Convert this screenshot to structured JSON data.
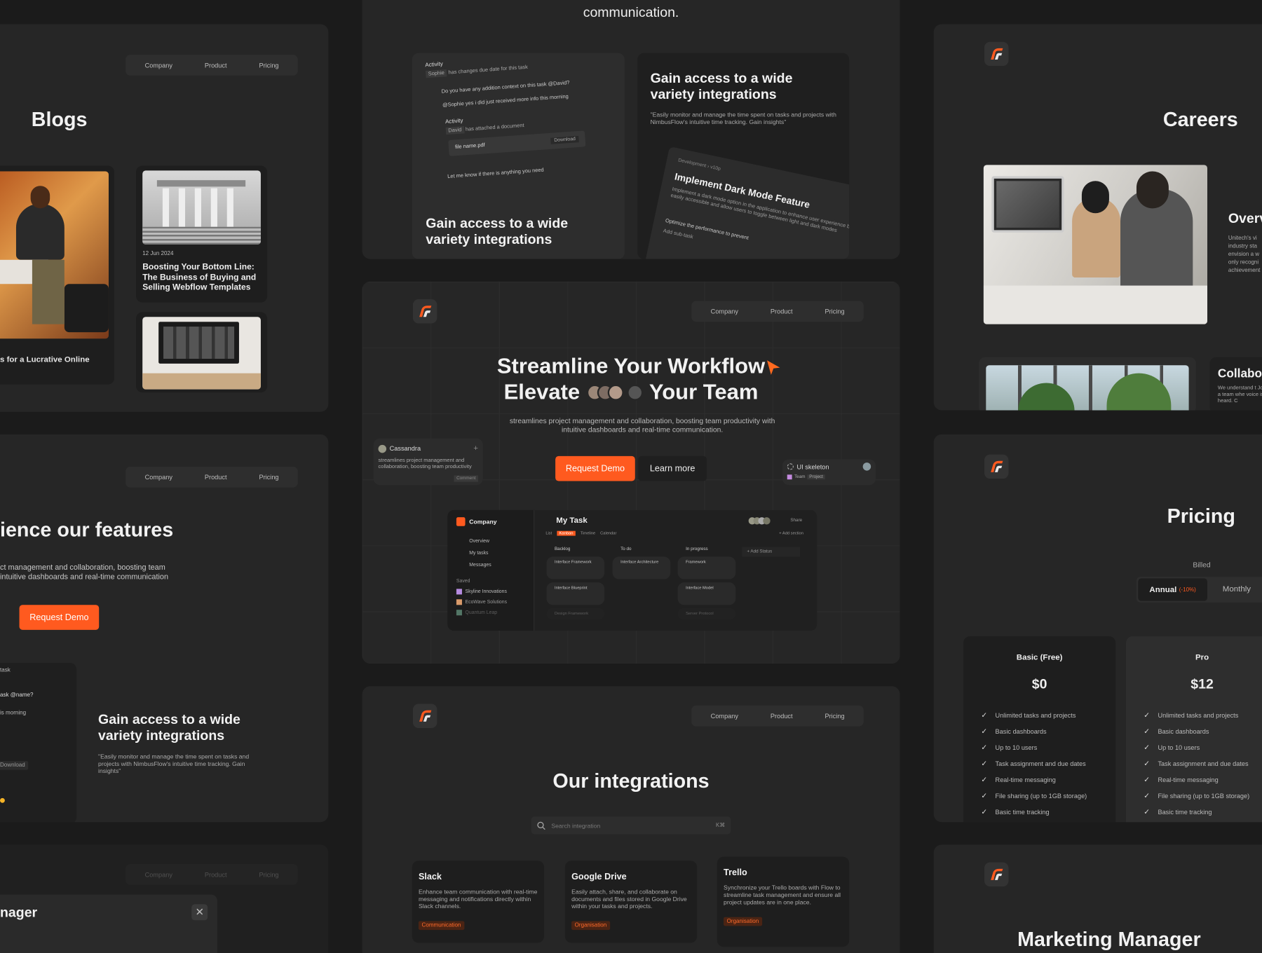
{
  "nav": {
    "company": "Company",
    "product": "Product",
    "pricing": "Pricing"
  },
  "blogs": {
    "title": "Blogs",
    "card1_date": "12 Jun 2024",
    "card1_title": "Boosting Your Bottom Line: The Business of Buying and Selling Webflow Templates",
    "card_left_caption": "s for a Lucrative Online"
  },
  "features": {
    "title": "ience our features",
    "desc": "ct management and collaboration, boosting team intuitive dashboards and real-time communication",
    "button": "Request Demo",
    "gain_title": "Gain access to a wide variety integrations",
    "gain_desc": "\"Easily monitor and manage the time spent on tasks and projects with NimbusFlow's intuitive time tracking. Gain insights\"",
    "chat_lines": [
      "task",
      "ask @name?",
      "is morning",
      "Download"
    ]
  },
  "manager_partial": {
    "title": "nager"
  },
  "top_center": {
    "text": "communication.",
    "activity_label": "Activity",
    "sophie": "Sophie",
    "sophie_action": "has changes due date for this task",
    "q1": "Do you have any addition context on this task @David?",
    "q2": "@Sophie yes i did just received more info this morning",
    "activity2": "Activity",
    "david": "David",
    "david_action": "has attached a document",
    "file": "file name.pdf",
    "download": "Download",
    "last": "Let me know if there is anything you need",
    "gain_left": "Gain access to a wide variety integrations",
    "gain_right": "Gain access to a wide variety integrations",
    "gain_right_desc": "\"Easily monitor and manage the time spent on tasks and projects with NimbusFlow's intuitive time tracking. Gain insights\"",
    "crumb1": "Development",
    "crumb2": "v10p",
    "task_title": "Implement Dark Mode Feature",
    "task_desc": "Implement a dark mode option in the application to enhance user experience be easily accessible and allow users to toggle between light and dark modes",
    "sub1": "Optimize the performance to prevent",
    "sub2": "Add sub-task"
  },
  "hero": {
    "line1": "Streamline Your Workflow",
    "line2a": "Elevate",
    "line2b": "Your Team",
    "desc": "streamlines project management and collaboration, boosting team productivity with intuitive dashboards and real-time communication.",
    "demo": "Request Demo",
    "learn": "Learn more",
    "cass_name": "Cassandra",
    "cass_text": "streamlines project management and collaboration, boosting team productivity",
    "cass_btn": "Comment",
    "ui_skel": "UI skeleton",
    "ui_team": "Team",
    "ui_project": "Project"
  },
  "app": {
    "company": "Company",
    "title": "My Task",
    "share": "Share",
    "views": [
      "List",
      "Kanban",
      "Timeline",
      "Calendar"
    ],
    "side": [
      "Overview",
      "My tasks",
      "Messages"
    ],
    "saved": "Saved",
    "projects": [
      "Skyline Innovations",
      "EcoWave Solutions",
      "Quantum Leap"
    ],
    "cols": [
      "Backlog",
      "To do",
      "In progress"
    ],
    "add_status": "+ Add Status",
    "add_section": "+ Add section",
    "t_backlog": [
      "Interface Framework",
      "Interface Blueprint",
      "Design Framework"
    ],
    "t_todo": [
      "Interface Architecture"
    ],
    "t_prog": [
      "Framework",
      "Interface Model",
      "Server Protocol"
    ]
  },
  "integrations": {
    "title": "Our integrations",
    "search": "Search integration",
    "kbd": "K⌘",
    "cards": [
      {
        "name": "Slack",
        "desc": "Enhance team communication with real-time messaging and notifications directly within Slack channels.",
        "tag": "Communication"
      },
      {
        "name": "Google Drive",
        "desc": "Easily attach, share, and collaborate on documents and files stored in Google Drive within your tasks and projects.",
        "tag": "Organisation"
      },
      {
        "name": "Trello",
        "desc": "Synchronize your Trello boards with Flow to streamline task management and ensure all project updates are in one place.",
        "tag": "Organisation"
      }
    ]
  },
  "careers": {
    "title": "Careers",
    "overview": "Overv",
    "overview_text": "Unitech's vi industry sta envision a w only recogni achievement",
    "collab": "Collabo",
    "collab_text": "We understand t Join a team whe voice is heard. C"
  },
  "pricing": {
    "title": "Pricing",
    "billed": "Billed",
    "annual": "Annual",
    "discount": "(-10%)",
    "monthly": "Monthly",
    "plans": [
      {
        "name": "Basic (Free)",
        "price": "$0"
      },
      {
        "name": "Pro",
        "price": "$12"
      }
    ],
    "features": [
      "Unlimited tasks and projects",
      "Basic dashboards",
      "Up to 10 users",
      "Task assignment and due dates",
      "Real-time messaging",
      "File sharing (up to 1GB storage)",
      "Basic time tracking"
    ]
  },
  "marketing": {
    "title": "Marketing Manager"
  },
  "colors": {
    "accent": "#ff5a1f",
    "bg": "#1b1b1b",
    "panel": "#262626"
  }
}
